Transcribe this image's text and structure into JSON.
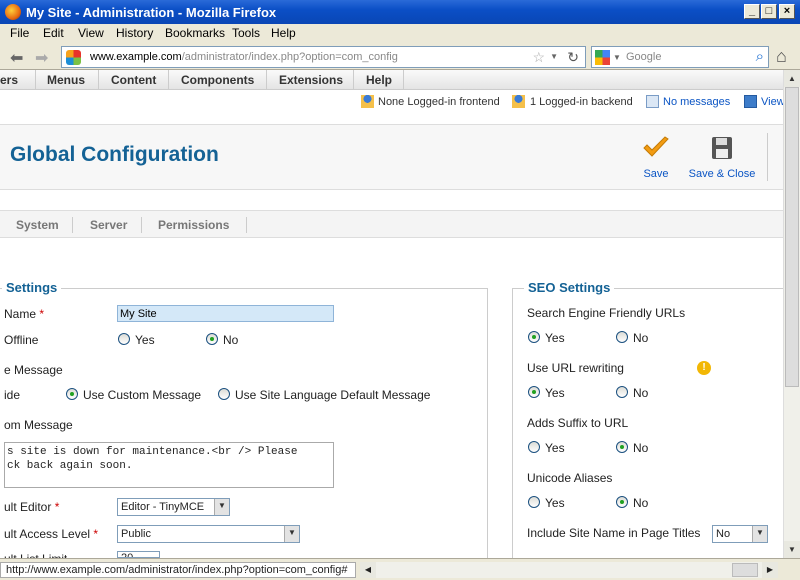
{
  "window": {
    "title": "My Site - Administration - Mozilla Firefox"
  },
  "menubar": [
    "File",
    "Edit",
    "View",
    "History",
    "Bookmarks",
    "Tools",
    "Help"
  ],
  "address": {
    "host": "www.example.com",
    "path": "/administrator/index.php?option=com_config"
  },
  "search": {
    "placeholder": "Google"
  },
  "cms_menu": [
    "ers",
    "Menus",
    "Content",
    "Components",
    "Extensions",
    "Help"
  ],
  "status": {
    "frontend": "None Logged-in frontend",
    "backend": "1 Logged-in backend",
    "messages": "No messages",
    "view": "View"
  },
  "toolbar": {
    "title": "Global Configuration",
    "save": "Save",
    "save_close": "Save & Close"
  },
  "tabs": [
    "System",
    "Server",
    "Permissions"
  ],
  "site_settings": {
    "legend": "Settings",
    "site_name_label": "Name",
    "site_name_value": "My Site",
    "offline_label": "Offline",
    "offline_yes": "Yes",
    "offline_no": "No",
    "offline_message_label": "e Message",
    "hide_label": "ide",
    "use_custom": "Use Custom Message",
    "use_language": "Use Site Language Default Message",
    "custom_message_label": "om Message",
    "custom_message_line1": "s site is down for maintenance.<br /> Please",
    "custom_message_line2": "ck back again soon.",
    "editor_label": "ult Editor",
    "editor_value": "Editor - TinyMCE",
    "access_label": "ult Access Level",
    "access_value": "Public",
    "list_limit_label": "ult List Limit",
    "list_limit_value": "20"
  },
  "seo_settings": {
    "legend": "SEO Settings",
    "sef_label": "Search Engine Friendly URLs",
    "rewrite_label": "Use URL rewriting",
    "suffix_label": "Adds Suffix to URL",
    "unicode_label": "Unicode Aliases",
    "sitename_label": "Include Site Name in Page Titles",
    "sitename_value": "No",
    "yes": "Yes",
    "no": "No"
  },
  "statusbar": {
    "text": "http://www.example.com/administrator/index.php?option=com_config#"
  },
  "colors": {
    "heading": "#146295",
    "titlebar": "#0b4fc6",
    "save_check": "#f39c12"
  }
}
